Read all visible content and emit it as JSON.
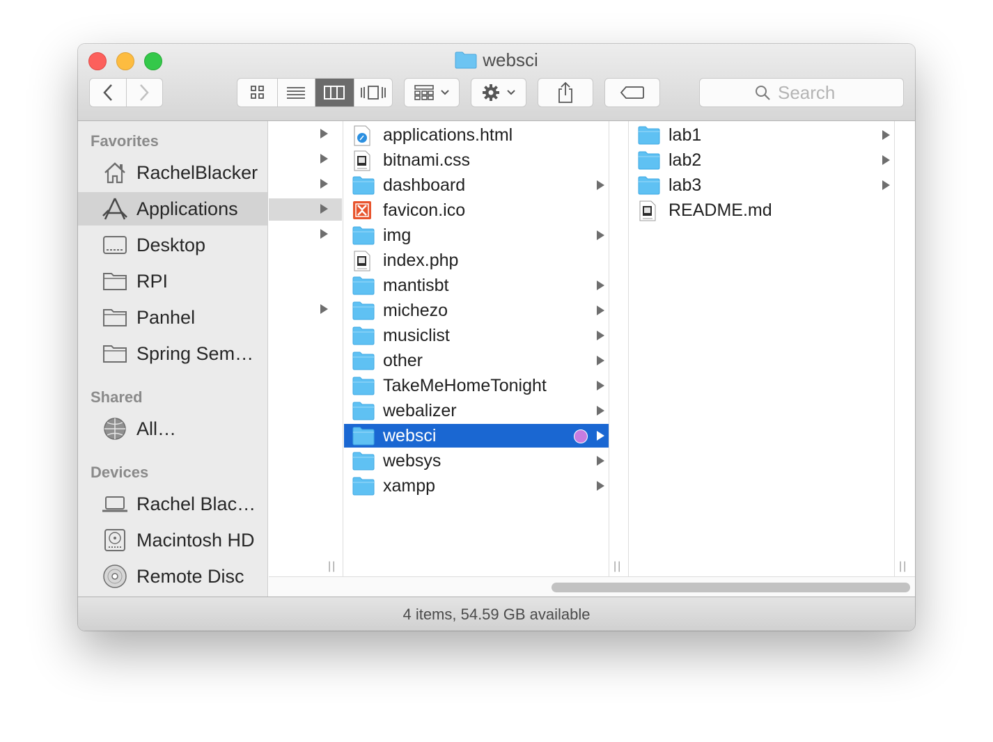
{
  "window": {
    "title": "websci"
  },
  "toolbar": {
    "view_modes": [
      "icon",
      "list",
      "column",
      "cover-flow"
    ],
    "active_view": "column",
    "search_placeholder": "Search"
  },
  "sidebar": {
    "sections": [
      {
        "label": "Favorites"
      },
      {
        "label": "Shared"
      },
      {
        "label": "Devices"
      }
    ],
    "favorites": [
      {
        "label": "RachelBlacker",
        "icon": "home-icon"
      },
      {
        "label": "Applications",
        "icon": "applications-icon",
        "selected": true
      },
      {
        "label": "Desktop",
        "icon": "desktop-icon"
      },
      {
        "label": "RPI",
        "icon": "folder-icon"
      },
      {
        "label": "Panhel",
        "icon": "folder-icon"
      },
      {
        "label": "Spring Sem…",
        "icon": "folder-icon"
      }
    ],
    "shared": [
      {
        "label": "All…",
        "icon": "network-icon"
      }
    ],
    "devices": [
      {
        "label": "Rachel Blac…",
        "icon": "laptop-icon"
      },
      {
        "label": "Macintosh HD",
        "icon": "hard-drive-icon"
      },
      {
        "label": "Remote Disc",
        "icon": "disc-icon"
      }
    ]
  },
  "column2": [
    {
      "name": "applications.html",
      "kind": "html"
    },
    {
      "name": "bitnami.css",
      "kind": "css"
    },
    {
      "name": "dashboard",
      "kind": "folder"
    },
    {
      "name": "favicon.ico",
      "kind": "ico"
    },
    {
      "name": "img",
      "kind": "folder"
    },
    {
      "name": "index.php",
      "kind": "php"
    },
    {
      "name": "mantisbt",
      "kind": "folder"
    },
    {
      "name": "michezo",
      "kind": "folder"
    },
    {
      "name": "musiclist",
      "kind": "folder"
    },
    {
      "name": "other",
      "kind": "folder"
    },
    {
      "name": "TakeMeHomeTonight",
      "kind": "folder"
    },
    {
      "name": "webalizer",
      "kind": "folder"
    },
    {
      "name": "websci",
      "kind": "folder",
      "selected": true,
      "tag_color": "#c77ce0"
    },
    {
      "name": "websys",
      "kind": "folder"
    },
    {
      "name": "xampp",
      "kind": "folder"
    }
  ],
  "column3": [
    {
      "name": "lab1",
      "kind": "folder"
    },
    {
      "name": "lab2",
      "kind": "folder"
    },
    {
      "name": "lab3",
      "kind": "folder"
    },
    {
      "name": "README.md",
      "kind": "md"
    }
  ],
  "status": {
    "text": "4 items, 54.59 GB available"
  },
  "colors": {
    "selection": "#1a67d2",
    "folder": "#5fc1f3",
    "tag_purple": "#c77ce0"
  }
}
